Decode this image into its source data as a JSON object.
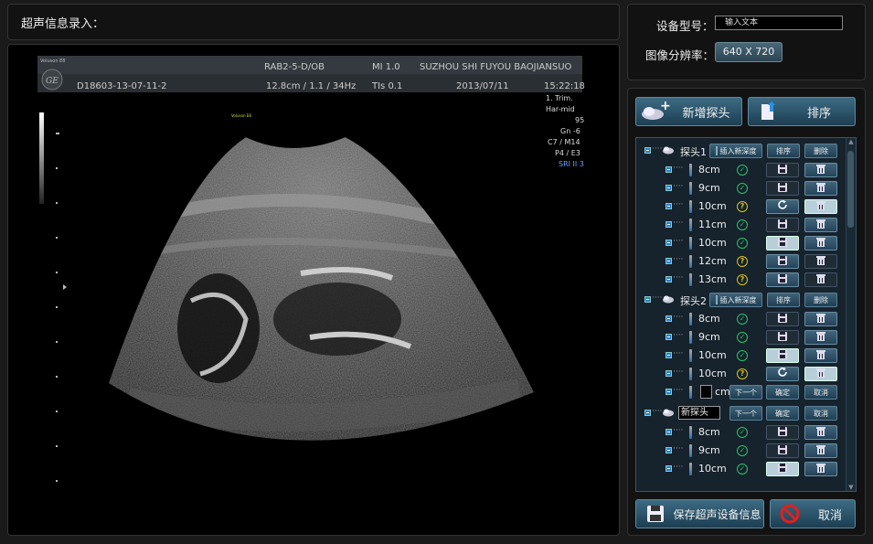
{
  "title": "超声信息录入：",
  "header": {
    "line1": [
      "RAB2-5-D/OB",
      "MI 1.0",
      "SUZHOU SHI FUYOU BAOJIANSUO"
    ],
    "line2": [
      "D18603-13-07-11-2",
      "12.8cm / 1.1 / 34Hz",
      "TIs 0.1",
      "2013/07/11",
      "15:22:18"
    ],
    "logo": "Voluson E8",
    "params": [
      "1. Trim.",
      "Har-mid",
      "95",
      "Gn  -6",
      "C7 / M14",
      "P4 / E3",
      "SRI II 3"
    ],
    "marker": "Voluson E8"
  },
  "device": {
    "model_label": "设备型号：",
    "model_placeholder": "输入文本",
    "res_label": "图像分辨率：",
    "res_value": "640 X 720"
  },
  "buttons": {
    "add_probe": "新增探头",
    "sort": "排序",
    "save": "保存超声设备信息",
    "cancel": "取消"
  },
  "tree": {
    "insert_depth": "插入新深度",
    "sort": "排序",
    "delete": "删除",
    "next": "下一个",
    "confirm": "确定",
    "cancel": "取消",
    "probes": [
      {
        "name": "探头1",
        "depths": [
          "8cm",
          "9cm",
          "10cm",
          "11cm",
          "10cm",
          "12cm",
          "13cm"
        ],
        "status": [
          "ok",
          "ok",
          "warn",
          "ok",
          "ok",
          "warn",
          "warn"
        ]
      },
      {
        "name": "探头2",
        "depths": [
          "8cm",
          "9cm",
          "10cm",
          "10cm"
        ],
        "status": [
          "ok",
          "ok",
          "ok",
          "warn"
        ],
        "new_unit": "cm"
      },
      {
        "name": "新探头",
        "depths": [
          "8cm",
          "9cm",
          "10cm"
        ],
        "status": [
          "ok",
          "ok",
          "ok"
        ]
      }
    ]
  },
  "colors": {
    "accent": "#2f6fa7",
    "ok": "#2bc36a",
    "warn": "#d6c21c"
  }
}
